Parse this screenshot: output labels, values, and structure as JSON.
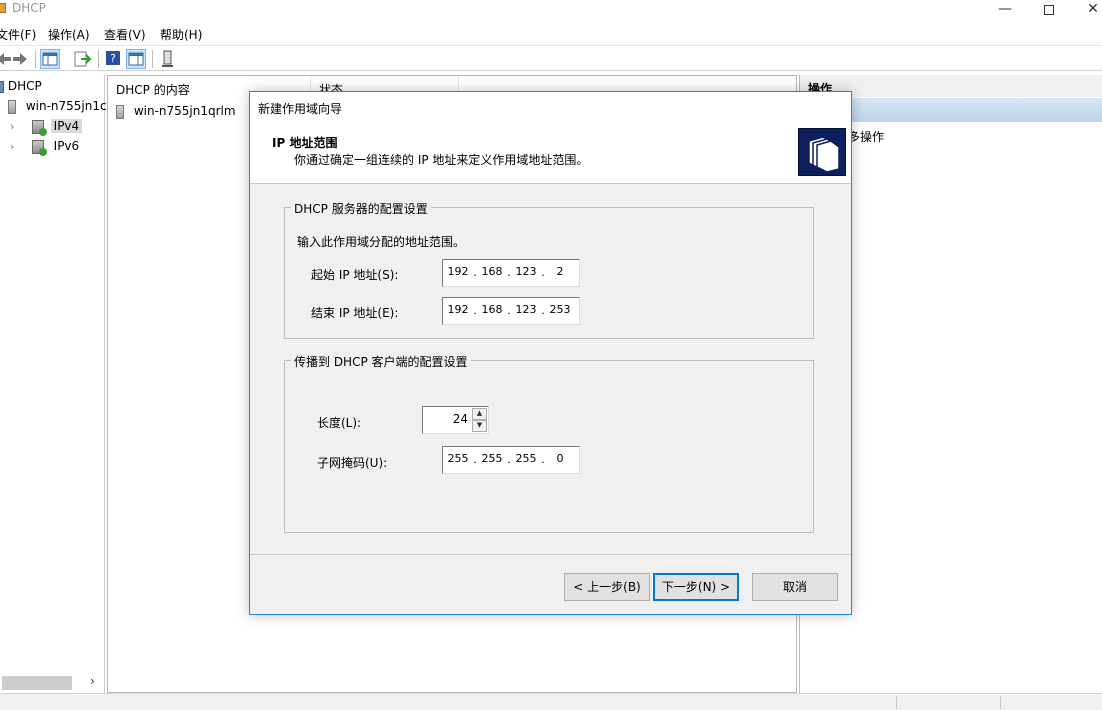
{
  "window": {
    "title": "DHCP"
  },
  "menu": [
    "文件(F)",
    "操作(A)",
    "查看(V)",
    "帮助(H)"
  ],
  "tree": {
    "root": "DHCP",
    "server": "win-n755jn1c",
    "ipv4": "IPv4",
    "ipv6": "IPv6"
  },
  "content": {
    "columns": [
      "DHCP 的内容",
      "状态"
    ],
    "rows": [
      "win-n755jn1qrlm"
    ]
  },
  "actions": {
    "title": "操作",
    "more": "多操作"
  },
  "dialog": {
    "title": "新建作用域向导",
    "header_title": "IP 地址范围",
    "header_subtitle": "你通过确定一组连续的 IP 地址来定义作用域地址范围。",
    "server_group": {
      "legend": "DHCP 服务器的配置设置",
      "instruction": "输入此作用域分配的地址范围。",
      "start_label": "起始 IP 地址(S):",
      "start_ip": [
        "192",
        "168",
        "123",
        "2"
      ],
      "end_label": "结束 IP 地址(E):",
      "end_ip": [
        "192",
        "168",
        "123",
        "253"
      ]
    },
    "client_group": {
      "legend": "传播到 DHCP 客户端的配置设置",
      "length_label": "长度(L):",
      "length_value": "24",
      "mask_label": "子网掩码(U):",
      "mask": [
        "255",
        "255",
        "255",
        "0"
      ]
    },
    "buttons": {
      "back": "< 上一步(B)",
      "next": "下一步(N) >",
      "cancel": "取消"
    }
  }
}
